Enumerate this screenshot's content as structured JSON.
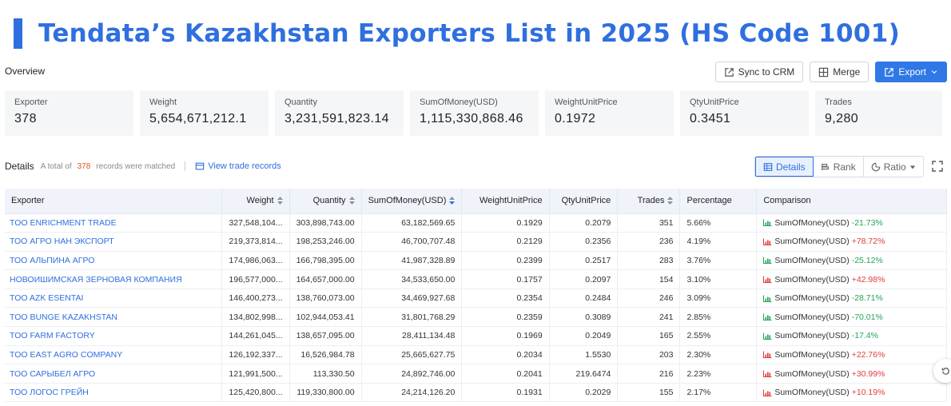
{
  "title": "Tendata’s Kazakhstan Exporters List in 2025 (HS Code 1001)",
  "overview_label": "Overview",
  "actions": {
    "sync": "Sync to CRM",
    "merge": "Merge",
    "export": "Export"
  },
  "stats": [
    {
      "label": "Exporter",
      "value": "378"
    },
    {
      "label": "Weight",
      "value": "5,654,671,212.1"
    },
    {
      "label": "Quantity",
      "value": "3,231,591,823.14"
    },
    {
      "label": "SumOfMoney(USD)",
      "value": "1,115,330,868.46"
    },
    {
      "label": "WeightUnitPrice",
      "value": "0.1972"
    },
    {
      "label": "QtyUnitPrice",
      "value": "0.3451"
    },
    {
      "label": "Trades",
      "value": "9,280"
    }
  ],
  "details": {
    "label": "Details",
    "prefix": "A total of",
    "count": "378",
    "suffix": "records were matched",
    "view_link": "View trade records"
  },
  "view_tabs": {
    "details": "Details",
    "rank": "Rank",
    "ratio": "Ratio"
  },
  "columns": [
    "Exporter",
    "Weight",
    "Quantity",
    "SumOfMoney(USD)",
    "WeightUnitPrice",
    "QtyUnitPrice",
    "Trades",
    "Percentage",
    "Comparison"
  ],
  "rows": [
    {
      "exporter": "TOO ENRICHMENT TRADE",
      "weight": "327,548,104...",
      "quantity": "303,898,743.00",
      "money": "63,182,569.65",
      "wup": "0.1929",
      "qup": "0.2079",
      "trades": "351",
      "pct": "5.66%",
      "cmp_label": "SumOfMoney(USD)",
      "cmp_val": "-21.73%",
      "dir": "neg"
    },
    {
      "exporter": "ТОО АГРО НАН ЭКСПОРТ",
      "weight": "219,373,814...",
      "quantity": "198,253,246.00",
      "money": "46,700,707.48",
      "wup": "0.2129",
      "qup": "0.2356",
      "trades": "236",
      "pct": "4.19%",
      "cmp_label": "SumOfMoney(USD)",
      "cmp_val": "+78.72%",
      "dir": "pos"
    },
    {
      "exporter": "ТОО АЛЬПИНА АГРО",
      "weight": "174,986,063...",
      "quantity": "166,798,395.00",
      "money": "41,987,328.89",
      "wup": "0.2399",
      "qup": "0.2517",
      "trades": "283",
      "pct": "3.76%",
      "cmp_label": "SumOfMoney(USD)",
      "cmp_val": "-25.12%",
      "dir": "neg"
    },
    {
      "exporter": "НОВОИШИМСКАЯ ЗЕРНОВАЯ КОМПАНИЯ",
      "weight": "196,577,000...",
      "quantity": "164,657,000.00",
      "money": "34,533,650.00",
      "wup": "0.1757",
      "qup": "0.2097",
      "trades": "154",
      "pct": "3.10%",
      "cmp_label": "SumOfMoney(USD)",
      "cmp_val": "+42.98%",
      "dir": "pos"
    },
    {
      "exporter": "TOO AZK ESENTAI",
      "weight": "146,400,273...",
      "quantity": "138,760,073.00",
      "money": "34,469,927.68",
      "wup": "0.2354",
      "qup": "0.2484",
      "trades": "246",
      "pct": "3.09%",
      "cmp_label": "SumOfMoney(USD)",
      "cmp_val": "-28.71%",
      "dir": "neg"
    },
    {
      "exporter": "TOO BUNGE KAZAKHSTAN",
      "weight": "134,802,998...",
      "quantity": "102,944,053.41",
      "money": "31,801,768.29",
      "wup": "0.2359",
      "qup": "0.3089",
      "trades": "241",
      "pct": "2.85%",
      "cmp_label": "SumOfMoney(USD)",
      "cmp_val": "-70.01%",
      "dir": "neg"
    },
    {
      "exporter": "TOO FARM FACTORY",
      "weight": "144,261,045...",
      "quantity": "138,657,095.00",
      "money": "28,411,134.48",
      "wup": "0.1969",
      "qup": "0.2049",
      "trades": "165",
      "pct": "2.55%",
      "cmp_label": "SumOfMoney(USD)",
      "cmp_val": "-17.4%",
      "dir": "neg"
    },
    {
      "exporter": "TOO EAST AGRO COMPANY",
      "weight": "126,192,337...",
      "quantity": "16,526,984.78",
      "money": "25,665,627.75",
      "wup": "0.2034",
      "qup": "1.5530",
      "trades": "203",
      "pct": "2.30%",
      "cmp_label": "SumOfMoney(USD)",
      "cmp_val": "+22.76%",
      "dir": "pos"
    },
    {
      "exporter": "ТОО САРЫБЕЛ АГРО",
      "weight": "121,991,500...",
      "quantity": "113,330.50",
      "money": "24,892,746.00",
      "wup": "0.2041",
      "qup": "219.6474",
      "trades": "216",
      "pct": "2.23%",
      "cmp_label": "SumOfMoney(USD)",
      "cmp_val": "+30.99%",
      "dir": "pos"
    },
    {
      "exporter": "ТОО ЛОГОС ГРЕЙН",
      "weight": "125,420,800...",
      "quantity": "119,330,800.00",
      "money": "24,214,126.20",
      "wup": "0.1931",
      "qup": "0.2029",
      "trades": "155",
      "pct": "2.17%",
      "cmp_label": "SumOfMoney(USD)",
      "cmp_val": "+10.19%",
      "dir": "pos"
    }
  ],
  "colors": {
    "accent": "#2f6fdf",
    "positive": "#e23b3b",
    "negative": "#23a35a",
    "highlight_count": "#e0542a"
  }
}
